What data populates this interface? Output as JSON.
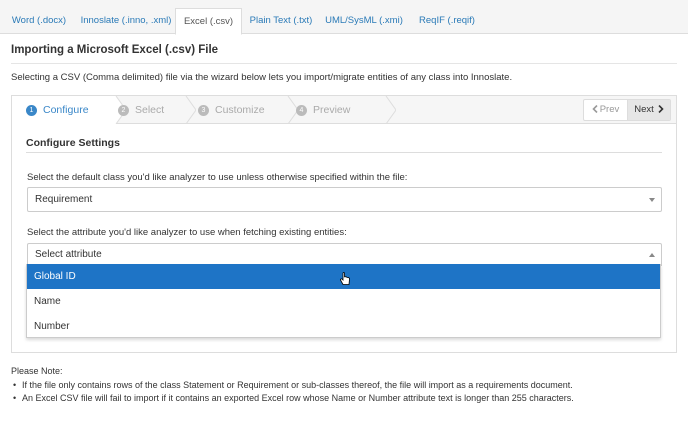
{
  "tabs": [
    {
      "label": "Word (.docx)",
      "active": false
    },
    {
      "label": "Innoslate (.inno, .xml)",
      "active": false
    },
    {
      "label": "Excel (.csv)",
      "active": true
    },
    {
      "label": "Plain Text (.txt)",
      "active": false
    },
    {
      "label": "UML/SysML (.xmi)",
      "active": false
    },
    {
      "label": "ReqIF (.reqif)",
      "active": false
    }
  ],
  "page": {
    "title": "Importing a Microsoft Excel (.csv) File",
    "intro": "Selecting a CSV (Comma delimited) file via the wizard below lets you import/migrate entities of any class into Innoslate."
  },
  "wizard": {
    "steps": [
      {
        "number": "1",
        "label": "Configure",
        "current": true
      },
      {
        "number": "2",
        "label": "Select",
        "current": false
      },
      {
        "number": "3",
        "label": "Customize",
        "current": false
      },
      {
        "number": "4",
        "label": "Preview",
        "current": false
      }
    ],
    "prev_label": "Prev",
    "next_label": "Next",
    "prev_icon": "chevron-left-icon",
    "next_icon": "chevron-right-icon"
  },
  "configure": {
    "title": "Configure Settings",
    "class_label": "Select the default class you'd like analyzer to use unless otherwise specified within the file:",
    "class_value": "Requirement",
    "attribute_label": "Select the attribute you'd like analyzer to use when fetching existing entities:",
    "attribute_placeholder": "Select attribute",
    "attribute_options": [
      {
        "label": "Global ID",
        "highlighted": true
      },
      {
        "label": "Name",
        "highlighted": false
      },
      {
        "label": "Number",
        "highlighted": false
      }
    ]
  },
  "notes": {
    "title": "Please Note:",
    "items": [
      "If the file only contains rows of the class Statement or Requirement or sub-classes thereof, the file will import as a requirements document.",
      "An Excel CSV file will fail to import if it contains an exported Excel row whose Name or Number attribute text is longer than 255 characters."
    ]
  },
  "colors": {
    "accent": "#3a87c8",
    "highlight": "#1e74c6",
    "link": "#2a7ab7"
  }
}
